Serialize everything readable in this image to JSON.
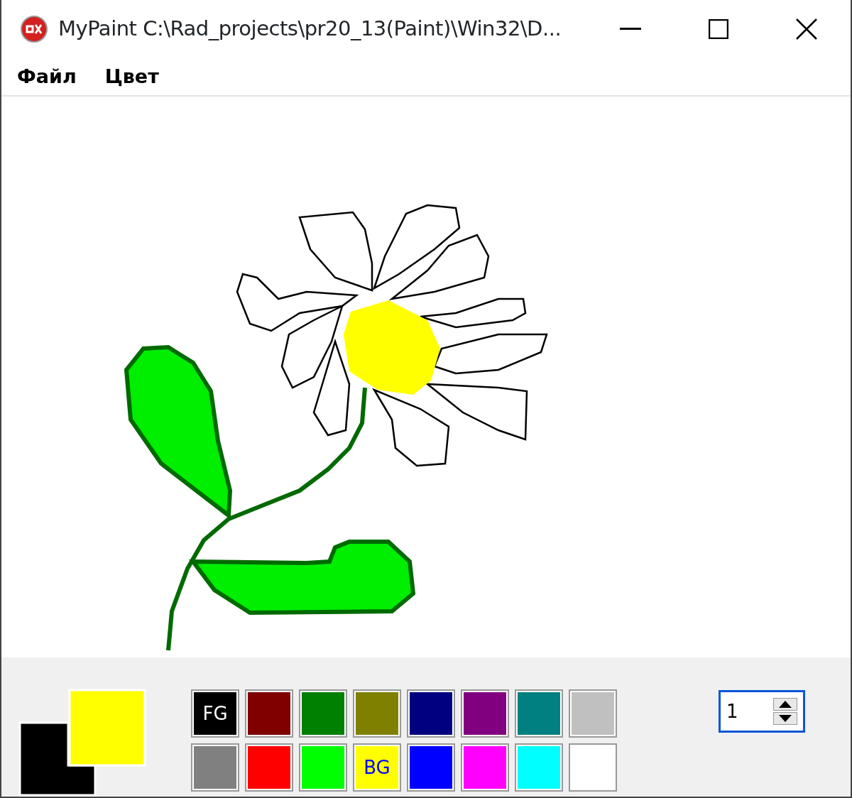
{
  "window": {
    "title": "MyPaint C:\\Rad_projects\\pr20_13(Paint)\\Win32\\D..."
  },
  "menu": [
    {
      "label": "Файл"
    },
    {
      "label": "Цвет"
    }
  ],
  "current_colors": {
    "foreground": {
      "color": "#000000"
    },
    "background": {
      "color": "#ffff00"
    }
  },
  "palette": [
    {
      "color": "#000000",
      "label": "FG"
    },
    {
      "color": "#800000"
    },
    {
      "color": "#008000"
    },
    {
      "color": "#808000"
    },
    {
      "color": "#000080"
    },
    {
      "color": "#800080"
    },
    {
      "color": "#008080"
    },
    {
      "color": "#c0c0c0"
    },
    {
      "color": "#808080"
    },
    {
      "color": "#ff0000"
    },
    {
      "color": "#00ff00"
    },
    {
      "color": "#ffff00",
      "label": "BG"
    },
    {
      "color": "#0000ff"
    },
    {
      "color": "#ff00ff"
    },
    {
      "color": "#00ffff"
    },
    {
      "color": "#ffffff"
    }
  ],
  "pen_width": {
    "value": "1"
  }
}
